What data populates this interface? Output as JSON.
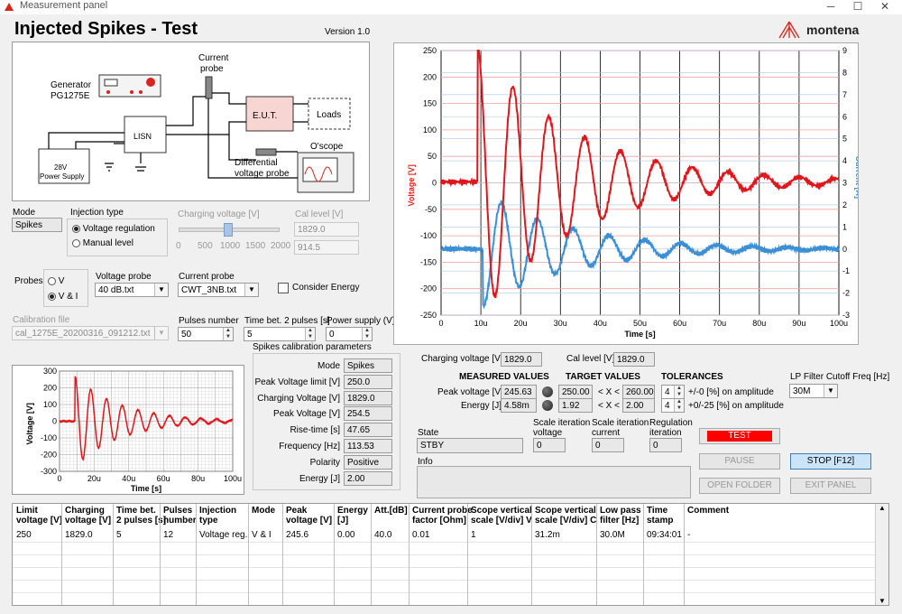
{
  "window": {
    "title": "Measurement panel",
    "version": "Version 1.0",
    "brand": "montena",
    "heading": "Injected Spikes - Test"
  },
  "schematic": {
    "generator": "Generator",
    "generator_model": "PG1275E",
    "current_probe": "Current",
    "current_probe2": "probe",
    "eut": "E.U.T.",
    "loads": "Loads",
    "lisn": "LISN",
    "oscope": "O'scope",
    "psu1": "28V",
    "psu2": "Power Supply",
    "diff1": "Differential",
    "diff2": "voltage probe"
  },
  "mode": {
    "label": "Mode",
    "value": "Spikes"
  },
  "injection": {
    "label": "Injection type",
    "opt1": "Voltage regulation",
    "opt2": "Manual level"
  },
  "charging_slider": {
    "label": "Charging voltage [V]",
    "ticks": [
      "0",
      "500",
      "1000",
      "1500",
      "2000"
    ],
    "value_fraction": 0.5
  },
  "cal_level": {
    "label": "Cal level [V]",
    "v1": "1829.0",
    "v2": "914.5"
  },
  "probes": {
    "label": "Probes",
    "opt1": "V",
    "opt2": "V & I"
  },
  "voltage_probe": {
    "label": "Voltage probe",
    "value": "40 dB.txt"
  },
  "current_probe_sel": {
    "label": "Current probe",
    "value": "CWT_3NB.txt"
  },
  "consider_energy": "Consider Energy",
  "calibration_file": {
    "label": "Calibration file",
    "value": "cal_1275E_20200316_091212.txt"
  },
  "pulses_number": {
    "label": "Pulses number",
    "value": "50"
  },
  "time_bet": {
    "label": "Time bet. 2 pulses [s]",
    "value": "5"
  },
  "power_supply": {
    "label": "Power supply (V)",
    "value": "0"
  },
  "spikes_cal": {
    "title": "Spikes calibration parameters",
    "rows": [
      {
        "label": "Mode",
        "value": "Spikes"
      },
      {
        "label": "Peak Voltage limit [V]",
        "value": "250.0"
      },
      {
        "label": "Charging Voltage [V]",
        "value": "1829.0"
      },
      {
        "label": "Peak Voltage [V]",
        "value": "254.5"
      },
      {
        "label": "Rise-time [s]",
        "value": "47.65"
      },
      {
        "label": "Frequency [Hz]",
        "value": "113.53"
      },
      {
        "label": "Polarity",
        "value": "Positive"
      },
      {
        "label": "Energy [J]",
        "value": "2.00"
      }
    ]
  },
  "small_chart": {
    "ylabel": "Voltage [V]",
    "xlabel": "Time [s]",
    "yticks": [
      "300",
      "200",
      "100",
      "0",
      "-100",
      "-200",
      "-300"
    ],
    "xticks": [
      "0",
      "20u",
      "40u",
      "60u",
      "80u",
      "100u"
    ]
  },
  "main_chart": {
    "ylabel": "Voltage [V]",
    "ylabel2": "Current [A]",
    "xlabel": "Time [s]",
    "yticks": [
      "250",
      "200",
      "150",
      "100",
      "50",
      "0",
      "-50",
      "-100",
      "-150",
      "-200",
      "-250"
    ],
    "y2ticks": [
      "9",
      "8",
      "7",
      "6",
      "5",
      "4",
      "3",
      "2",
      "1",
      "0",
      "-1",
      "-2",
      "-3"
    ],
    "xticks": [
      "0",
      "10u",
      "20u",
      "30u",
      "40u",
      "50u",
      "60u",
      "70u",
      "80u",
      "90u",
      "100u"
    ]
  },
  "measure": {
    "charging_label": "Charging voltage [V]",
    "charging_value": "1829.0",
    "cal_label": "Cal level [V]",
    "cal_value": "1829.0",
    "measured_h": "MEASURED VALUES",
    "target_h": "TARGET VALUES",
    "tol_h": "TOLERANCES",
    "pv_label": "Peak voltage [V]",
    "pv_value": "245.63",
    "pv_t1": "250.00",
    "pv_t2": "260.00",
    "pv_tol": "4",
    "pv_tol_txt": "+/-0 [%] on amplitude",
    "en_label": "Energy [J]",
    "en_value": "4.58m",
    "en_t1": "1.92",
    "en_t2": "2.00",
    "en_tol": "4",
    "en_tol_txt": "+0/-25 [%] on amplitude",
    "between": "< X <"
  },
  "lp_filter": {
    "label": "LP Filter Cutoff Freq [Hz]",
    "value": "30M"
  },
  "state": {
    "label": "State",
    "value": "STBY"
  },
  "scale_v": {
    "l1": "Scale iteration",
    "l2": "voltage",
    "value": "0"
  },
  "scale_c": {
    "l1": "Scale iteration",
    "l2": "current",
    "value": "0"
  },
  "reg_it": {
    "l1": "Regulation",
    "l2": "iteration",
    "value": "0"
  },
  "info_label": "Info",
  "buttons": {
    "test": "TEST",
    "pause": "PAUSE",
    "stop": "STOP [F12]",
    "open": "OPEN FOLDER",
    "exit": "EXIT PANEL"
  },
  "results": {
    "headers": [
      [
        "Limit",
        "voltage [V]"
      ],
      [
        "Charging",
        "voltage [V]"
      ],
      [
        "Time bet.",
        "2 pulses [s]"
      ],
      [
        "Pulses",
        "number"
      ],
      [
        "Injection",
        "type"
      ],
      [
        "Mode",
        ""
      ],
      [
        "Peak",
        "voltage [V]"
      ],
      [
        "Energy",
        "[J]"
      ],
      [
        "Att.[dB]",
        ""
      ],
      [
        "Current probe",
        "factor [Ohm]"
      ],
      [
        "Scope vertical",
        "scale [V/div] V"
      ],
      [
        "Scope vertical",
        "scale [V/div] C"
      ],
      [
        "Low pass",
        "filter [Hz]"
      ],
      [
        "Time",
        "stamp"
      ],
      [
        "Comment",
        ""
      ]
    ],
    "row": [
      "250",
      "1829.0",
      "5",
      "12",
      "Voltage reg.",
      "V & I",
      "245.6",
      "0.00",
      "40.0",
      "0.01",
      "1",
      "31.2m",
      "30.0M",
      "09:34:01",
      "-"
    ]
  }
}
